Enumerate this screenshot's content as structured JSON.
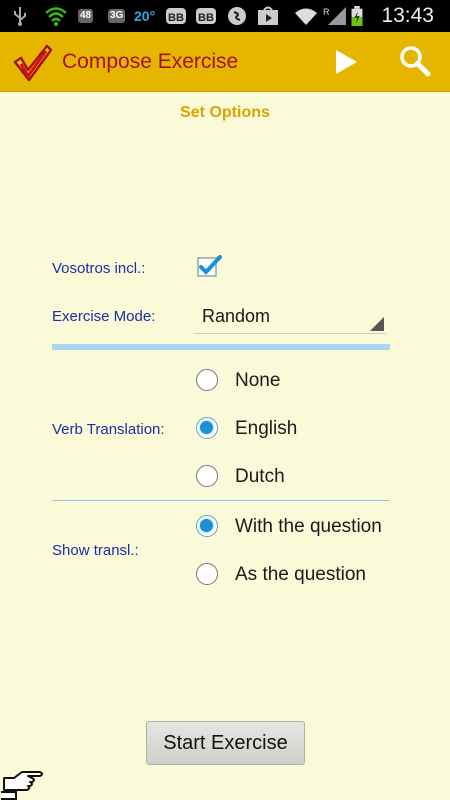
{
  "status_bar": {
    "time": "13:43",
    "badge_48": "48",
    "badge_3g": "3G",
    "temperature": "20°",
    "icons": [
      "usb-icon",
      "wifi-icon",
      "sms-icon",
      "network-icon",
      "bbm-icon",
      "bbm-icon",
      "shazam-icon",
      "play-store-icon",
      "wifi-signal-icon",
      "no-sim-icon",
      "battery-icon"
    ]
  },
  "app_bar": {
    "title": "Compose Exercise",
    "accent_color": "#e6b500",
    "title_color": "#a3121a"
  },
  "section_title": "Set Options",
  "vosotros": {
    "label": "Vosotros incl.:",
    "checked": true
  },
  "exercise_mode": {
    "label": "Exercise Mode:",
    "selected": "Random"
  },
  "verb_translation": {
    "label": "Verb Translation:",
    "options": [
      "None",
      "English",
      "Dutch"
    ],
    "selected": "English"
  },
  "show_translation": {
    "label": "Show transl.:",
    "options": [
      "With the question",
      "As the question"
    ],
    "selected": "With the question"
  },
  "start_button": "Start Exercise"
}
